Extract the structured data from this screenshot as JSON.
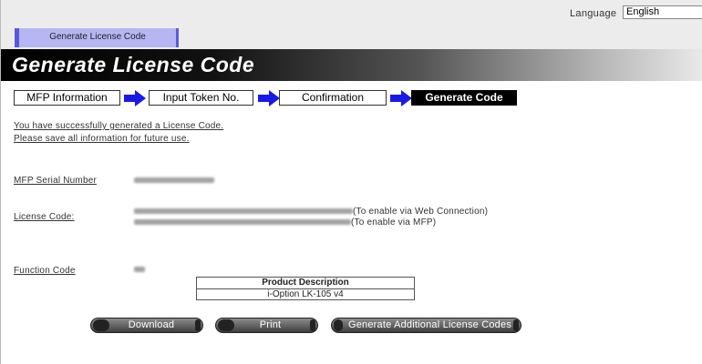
{
  "header": {
    "language_label": "Language",
    "language_selected": "English",
    "tab_label": "Generate License Code"
  },
  "page_title": "Generate License Code",
  "steps": [
    {
      "label": "MFP Information",
      "active": false
    },
    {
      "label": "Input Token No.",
      "active": false
    },
    {
      "label": "Confirmation",
      "active": false
    },
    {
      "label": "Generate Code",
      "active": true
    }
  ],
  "messages": {
    "success": "You have successfully generated a License Code.",
    "save_note": "Please save all information for future use."
  },
  "fields": {
    "serial_label": "MFP Serial Number",
    "license_label": "License Code:",
    "license_web_note": "(To enable via Web Connection)",
    "license_mfp_note": "(To enable via MFP)",
    "function_label": "Function Code"
  },
  "product": {
    "header": "Product Description",
    "value": "i-Option LK-105 v4"
  },
  "buttons": {
    "download": "Download",
    "print": "Print",
    "generate_more": "Generate Additional License Codes"
  },
  "colors": {
    "active_step": "#000000",
    "arrow": "#1a1ae6",
    "tab_bg": "#b6b6f3"
  }
}
